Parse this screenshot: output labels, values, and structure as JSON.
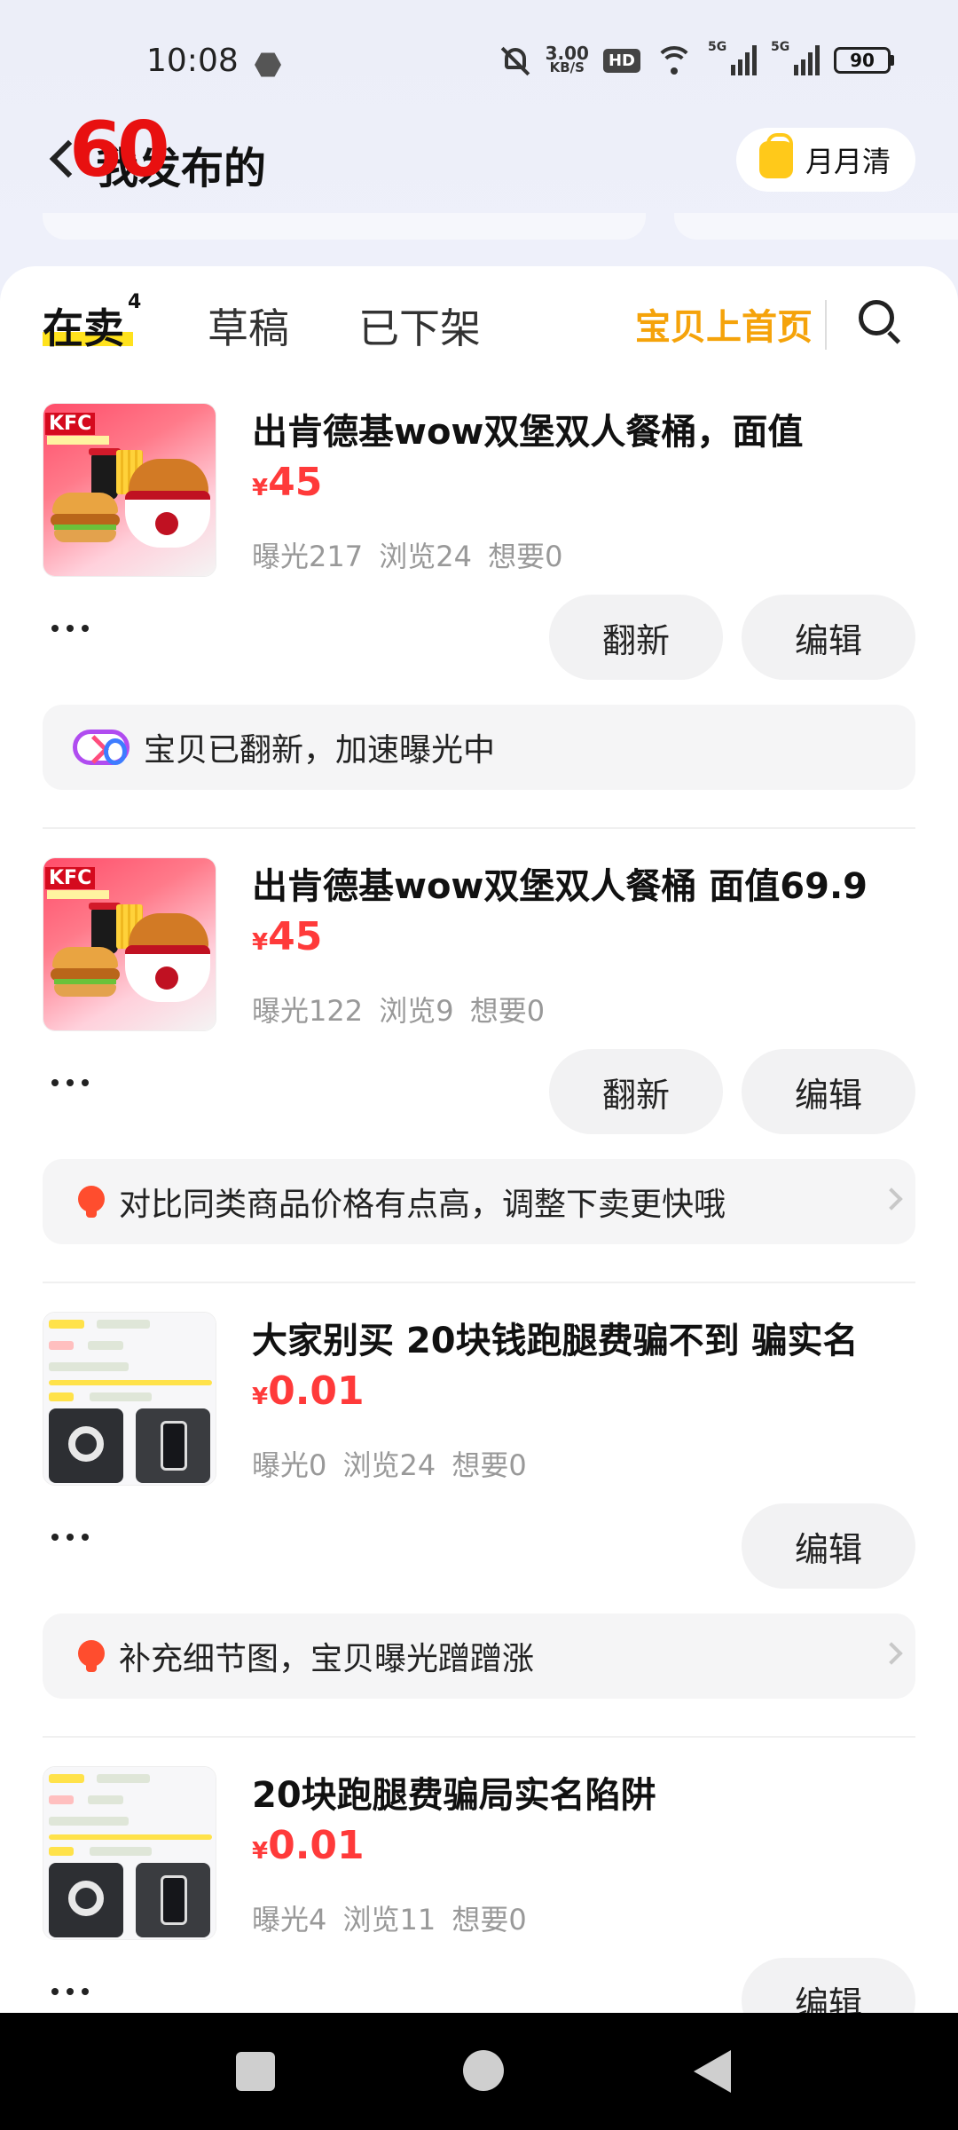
{
  "status_bar": {
    "time": "10:08",
    "net_speed_value": "3.00",
    "net_speed_unit": "KB/S",
    "hd_label": "HD",
    "signal_label_1": "5G",
    "signal_label_2": "5G",
    "battery": "90"
  },
  "header": {
    "fps_badge": "60",
    "title": "我发布的",
    "monthly_label": "月月清"
  },
  "tabs": {
    "selling": "在卖",
    "selling_count": "4",
    "drafts": "草稿",
    "removed": "已下架",
    "promo_link": "宝贝上首页"
  },
  "items": [
    {
      "title": "出肯德基wow双堡双人餐桶，面值",
      "currency": "¥",
      "price": "45",
      "stats": "曝光217 浏览24 想要0",
      "refresh_label": "翻新",
      "edit_label": "编辑",
      "tip": "宝贝已翻新，加速曝光中",
      "tip_icon": "boost-icon"
    },
    {
      "title": "出肯德基wow双堡双人餐桶 面值69.9",
      "currency": "¥",
      "price": "45",
      "stats": "曝光122 浏览9 想要0",
      "refresh_label": "翻新",
      "edit_label": "编辑",
      "tip": "对比同类商品价格有点高，调整下卖更快哦",
      "tip_icon": "lightbulb-icon"
    },
    {
      "title": "大家别买 20块钱跑腿费骗不到 骗实名",
      "currency": "¥",
      "price": "0.01",
      "stats": "曝光0 浏览24 想要0",
      "edit_label": "编辑",
      "tip": "补充细节图，宝贝曝光蹭蹭涨",
      "tip_icon": "lightbulb-icon"
    },
    {
      "title": "20块跑腿费骗局实名陷阱",
      "currency": "¥",
      "price": "0.01",
      "stats": "曝光4 浏览11 想要0",
      "edit_label": "编辑"
    }
  ],
  "thumbnail_text": {
    "kfc_logo": "KFC"
  },
  "colors": {
    "price_red": "#ff3a3a",
    "accent_yellow": "#ffe21d",
    "promo_orange": "#f5a30a",
    "fps_red": "#e81010"
  }
}
